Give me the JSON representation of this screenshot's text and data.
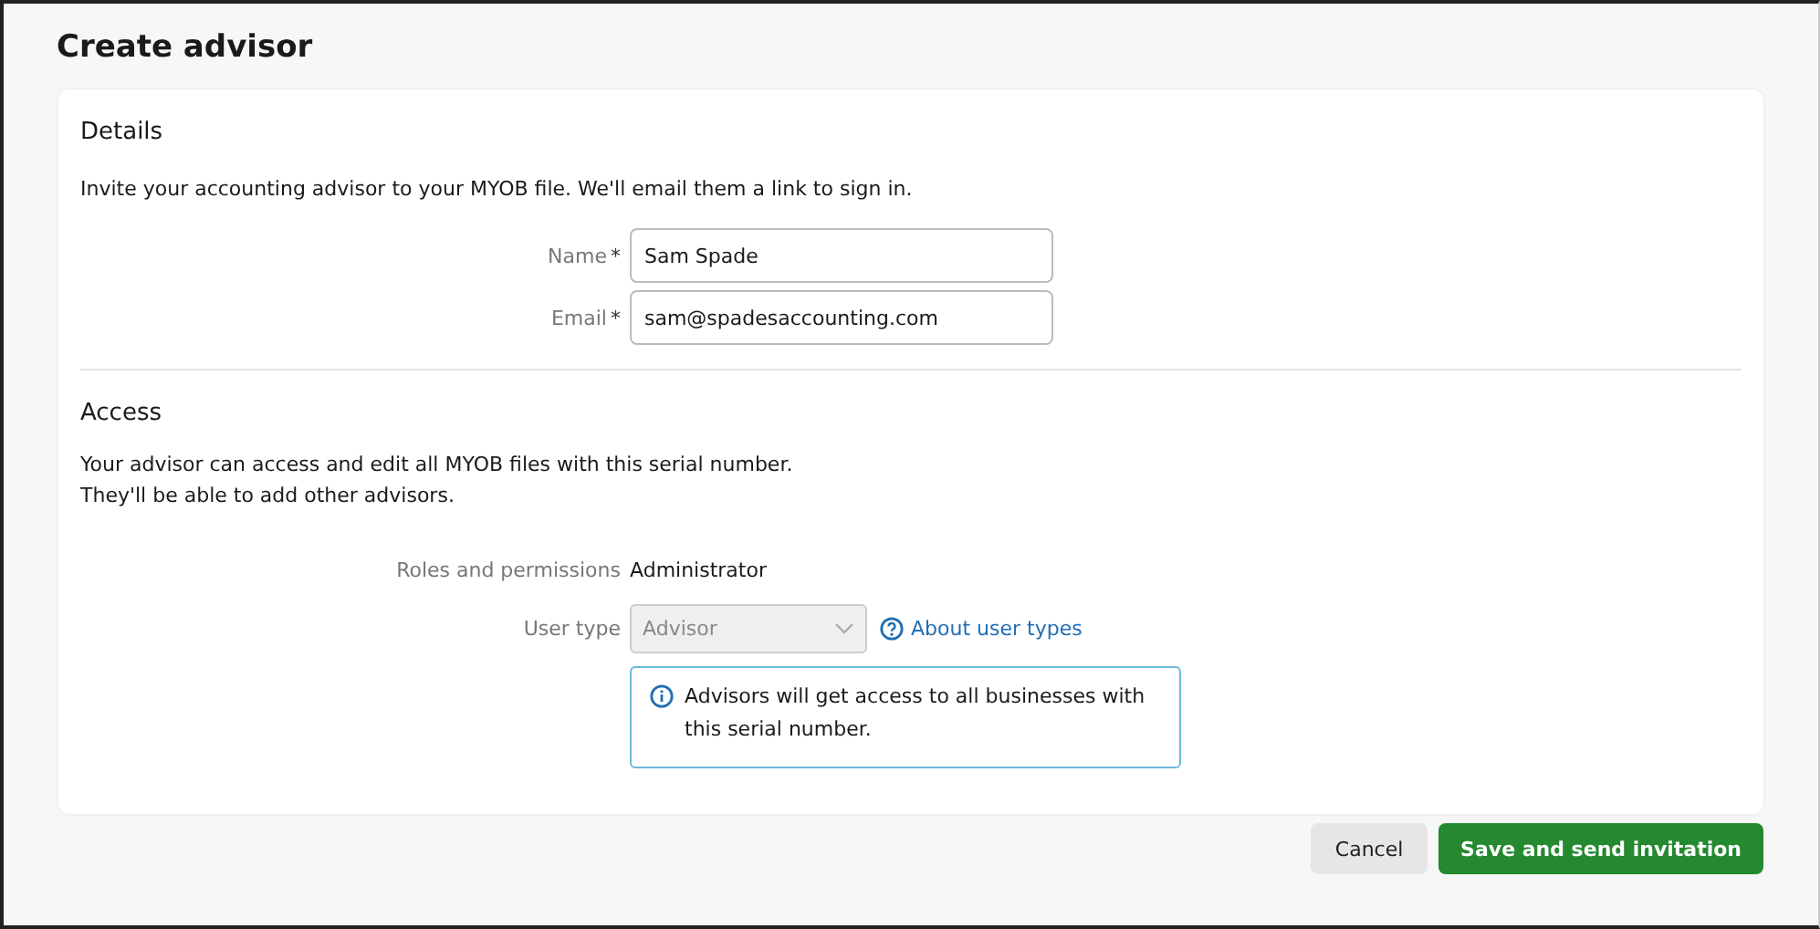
{
  "page": {
    "title": "Create advisor"
  },
  "details": {
    "heading": "Details",
    "description": "Invite your accounting advisor to your MYOB file. We'll email them a link to sign in.",
    "fields": [
      {
        "label": "Name",
        "required_mark": "*",
        "value": "Sam Spade"
      },
      {
        "label": "Email",
        "required_mark": "*",
        "value": "sam@spadesaccounting.com"
      }
    ]
  },
  "access": {
    "heading": "Access",
    "description": [
      "Your advisor can access and edit all MYOB files with this serial number.",
      "They'll be able to add other advisors."
    ],
    "roles": {
      "label": "Roles and permissions",
      "value": "Administrator"
    },
    "user_type": {
      "label": "User type",
      "value": "Advisor",
      "disabled": true,
      "help_link": "About user types"
    },
    "info": "Advisors will get access to all businesses with this serial number."
  },
  "buttons": [
    {
      "label": "Cancel",
      "kind": "secondary"
    },
    {
      "label": "Save and send invitation",
      "kind": "primary"
    }
  ]
}
